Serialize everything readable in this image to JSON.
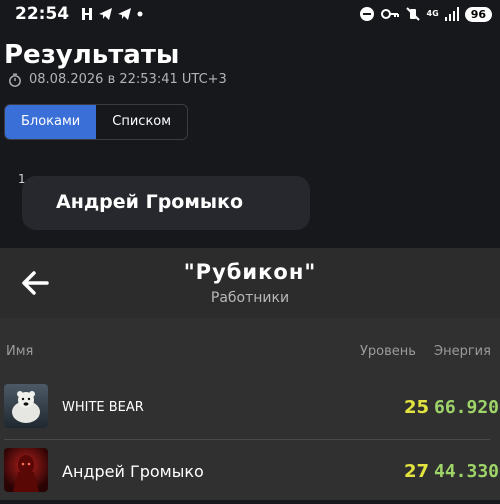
{
  "status_bar": {
    "time": "22:54",
    "network": "4G",
    "battery": "96"
  },
  "header": {
    "title": "Результаты",
    "timestamp": "08.08.2026 в 22:53:41 UTC+3"
  },
  "view_toggle": {
    "blocks_label": "Блоками",
    "list_label": "Списком",
    "active": "blocks"
  },
  "results": [
    {
      "index": "1",
      "name": "Андрей Громыко"
    }
  ],
  "panel": {
    "title": "\"Рубикон\"",
    "subtitle": "Работники",
    "columns": {
      "name": "Имя",
      "level": "Уровень",
      "energy": "Энергия"
    },
    "rows": [
      {
        "name": "WHITE BEAR",
        "level": "25",
        "energy": "66.920",
        "avatar_icon": "polar-bear-icon"
      },
      {
        "name": "Андрей Громыко",
        "level": "27",
        "energy": "44.330",
        "avatar_icon": "red-figure-icon"
      }
    ]
  },
  "colors": {
    "accent": "#3a6fd8",
    "level": "#e3e340",
    "energy": "#9ed468",
    "background": "#17181c",
    "panel": "#303030"
  }
}
